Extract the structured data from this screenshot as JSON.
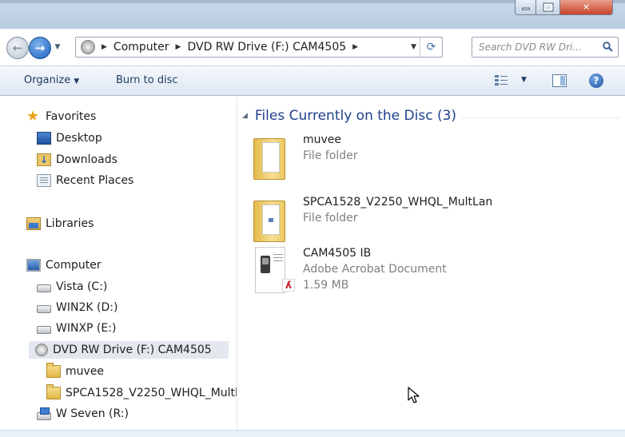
{
  "window": {
    "controls": {
      "minimize": "minimize",
      "maximize": "maximize",
      "close": "close"
    }
  },
  "address_bar": {
    "breadcrumbs": [
      "Computer",
      "DVD RW Drive (F:) CAM4505"
    ],
    "search_placeholder": "Search DVD RW Dri..."
  },
  "toolbar": {
    "organize_label": "Organize",
    "burn_label": "Burn to disc"
  },
  "navigation": {
    "favorites": {
      "label": "Favorites",
      "items": [
        "Desktop",
        "Downloads",
        "Recent Places"
      ]
    },
    "libraries": {
      "label": "Libraries"
    },
    "computer": {
      "label": "Computer",
      "drives": [
        "Vista (C:)",
        "WIN2K (D:)",
        "WINXP (E:)",
        "DVD RW Drive (F:) CAM4505"
      ],
      "dvd_children": [
        "muvee",
        "SPCA1528_V2250_WHQL_Multl"
      ],
      "network": "W Seven (R:)"
    },
    "selected": "DVD RW Drive (F:) CAM4505"
  },
  "content": {
    "group_title": "Files Currently on the Disc (3)",
    "files": [
      {
        "name": "muvee",
        "type": "File folder",
        "size": "",
        "icon": "folder-icon"
      },
      {
        "name": "SPCA1528_V2250_WHQL_MultLan",
        "type": "File folder",
        "size": "",
        "icon": "folder-icon"
      },
      {
        "name": "CAM4505 IB",
        "type": "Adobe Acrobat Document",
        "size": "1.59 MB",
        "icon": "pdf-icon"
      }
    ]
  },
  "colors": {
    "title_blue": "#1e3f8c",
    "selection": "#e3e8ef",
    "command_bar_text": "#1e3a5f"
  }
}
